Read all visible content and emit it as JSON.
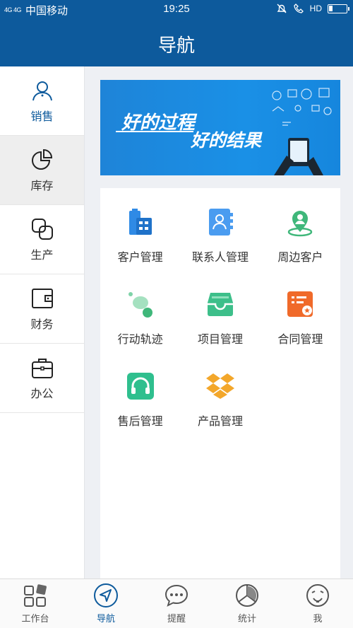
{
  "status": {
    "network": "4G 4G",
    "carrier": "中国移动",
    "time": "19:25",
    "hd": "HD"
  },
  "header": {
    "title": "导航"
  },
  "sidebar": {
    "items": [
      {
        "label": "销售",
        "icon": "user-icon"
      },
      {
        "label": "库存",
        "icon": "pie-chart-icon"
      },
      {
        "label": "生产",
        "icon": "overlap-squares-icon"
      },
      {
        "label": "财务",
        "icon": "wallet-icon"
      },
      {
        "label": "办公",
        "icon": "briefcase-icon"
      }
    ]
  },
  "banner": {
    "text1": "好的过程",
    "text2": "好的结果"
  },
  "modules": [
    {
      "label": "客户管理",
      "icon": "building-icon",
      "color": "#2f8ae5"
    },
    {
      "label": "联系人管理",
      "icon": "contacts-book-icon",
      "color": "#4a9cf0"
    },
    {
      "label": "周边客户",
      "icon": "location-pin-icon",
      "color": "#3fb77a"
    },
    {
      "label": "行动轨迹",
      "icon": "trail-dots-icon",
      "color": "#3fb77a"
    },
    {
      "label": "项目管理",
      "icon": "inbox-tray-icon",
      "color": "#3dbf8a"
    },
    {
      "label": "合同管理",
      "icon": "contract-icon",
      "color": "#f06a2a"
    },
    {
      "label": "售后管理",
      "icon": "headset-icon",
      "color": "#2fbf8e"
    },
    {
      "label": "产品管理",
      "icon": "dropbox-box-icon",
      "color": "#f3a72b"
    }
  ],
  "tabbar": {
    "items": [
      {
        "label": "工作台",
        "icon": "workbench-icon"
      },
      {
        "label": "导航",
        "icon": "navigation-arrow-icon"
      },
      {
        "label": "提醒",
        "icon": "chat-bubble-icon"
      },
      {
        "label": "统计",
        "icon": "stats-pie-icon"
      },
      {
        "label": "我",
        "icon": "face-icon"
      }
    ]
  },
  "colors": {
    "brand": "#0d5a9c",
    "background": "#eef0f4"
  }
}
